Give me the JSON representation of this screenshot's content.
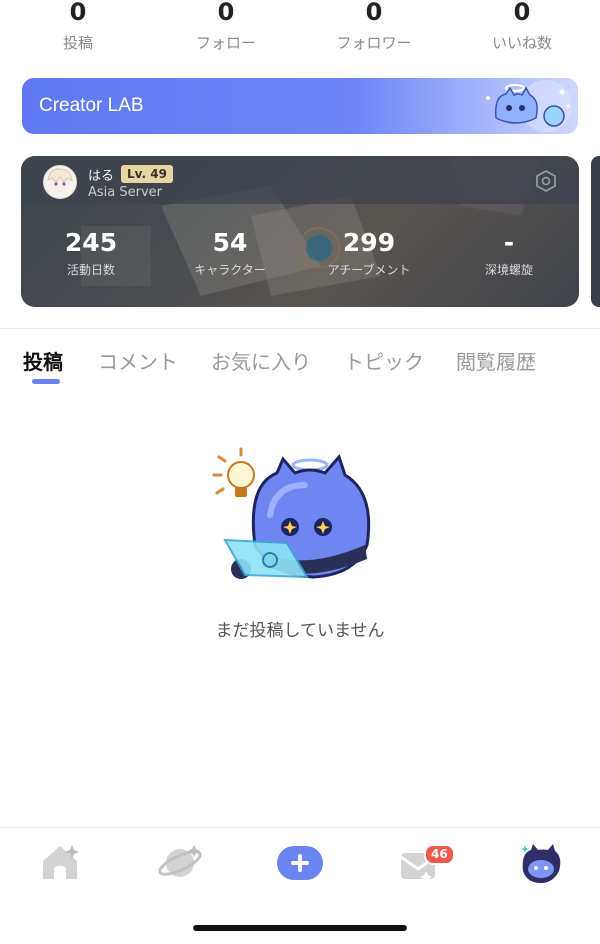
{
  "profile_stats": [
    {
      "value": "0",
      "label": "投稿"
    },
    {
      "value": "0",
      "label": "フォロー"
    },
    {
      "value": "0",
      "label": "フォロワー"
    },
    {
      "value": "0",
      "label": "いいね数"
    }
  ],
  "creator_lab": {
    "title": "Creator LAB"
  },
  "game_card": {
    "username": "はる",
    "level": "Lv. 49",
    "server": "Asia Server",
    "stats": [
      {
        "value": "245",
        "label": "活動日数"
      },
      {
        "value": "54",
        "label": "キャラクター"
      },
      {
        "value": "299",
        "label": "アチーブメント"
      },
      {
        "value": "-",
        "label": "深境螺旋"
      }
    ]
  },
  "tabs": [
    {
      "label": "投稿",
      "active": true
    },
    {
      "label": "コメント",
      "active": false
    },
    {
      "label": "お気に入り",
      "active": false
    },
    {
      "label": "トピック",
      "active": false
    },
    {
      "label": "閲覧履歴",
      "active": false
    }
  ],
  "empty_state": {
    "message": "まだ投稿していません"
  },
  "bottom_nav": {
    "items": [
      {
        "icon": "home-icon"
      },
      {
        "icon": "planet-icon"
      },
      {
        "icon": "plus-icon"
      },
      {
        "icon": "mail-icon"
      },
      {
        "icon": "profile-mascot-icon"
      }
    ],
    "mail_badge": "46"
  },
  "colors": {
    "accent": "#6B84F3",
    "badge": "#EF5A4C"
  }
}
